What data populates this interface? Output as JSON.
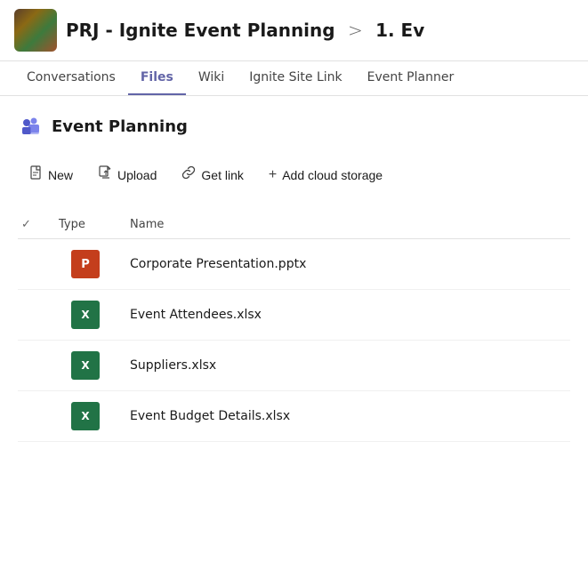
{
  "header": {
    "title_prefix": "PRJ - Ignite Event Planning",
    "chevron": ">",
    "title_bold": "1. Ev",
    "full_title": "PRJ - Ignite Event Planning  >  1. Ev"
  },
  "nav": {
    "tabs": [
      {
        "id": "conversations",
        "label": "Conversations",
        "active": false
      },
      {
        "id": "files",
        "label": "Files",
        "active": true
      },
      {
        "id": "wiki",
        "label": "Wiki",
        "active": false
      },
      {
        "id": "ignite-site-link",
        "label": "Ignite Site Link",
        "active": false
      },
      {
        "id": "event-planner",
        "label": "Event Planner",
        "active": false
      }
    ]
  },
  "section": {
    "title": "Event Planning"
  },
  "toolbar": {
    "new_label": "New",
    "upload_label": "Upload",
    "get_link_label": "Get link",
    "add_cloud_label": "Add cloud storage"
  },
  "table": {
    "columns": [
      {
        "id": "check",
        "label": "✓"
      },
      {
        "id": "type",
        "label": "Type"
      },
      {
        "id": "name",
        "label": "Name"
      }
    ],
    "rows": [
      {
        "id": 1,
        "type": "pptx",
        "name": "Corporate Presentation.pptx"
      },
      {
        "id": 2,
        "type": "xlsx",
        "name": "Event Attendees.xlsx"
      },
      {
        "id": 3,
        "type": "xlsx",
        "name": "Suppliers.xlsx"
      },
      {
        "id": 4,
        "type": "xlsx",
        "name": "Event Budget Details.xlsx"
      }
    ]
  },
  "icons": {
    "new": "🗋",
    "upload": "⬆",
    "link": "🔗",
    "add": "+"
  }
}
